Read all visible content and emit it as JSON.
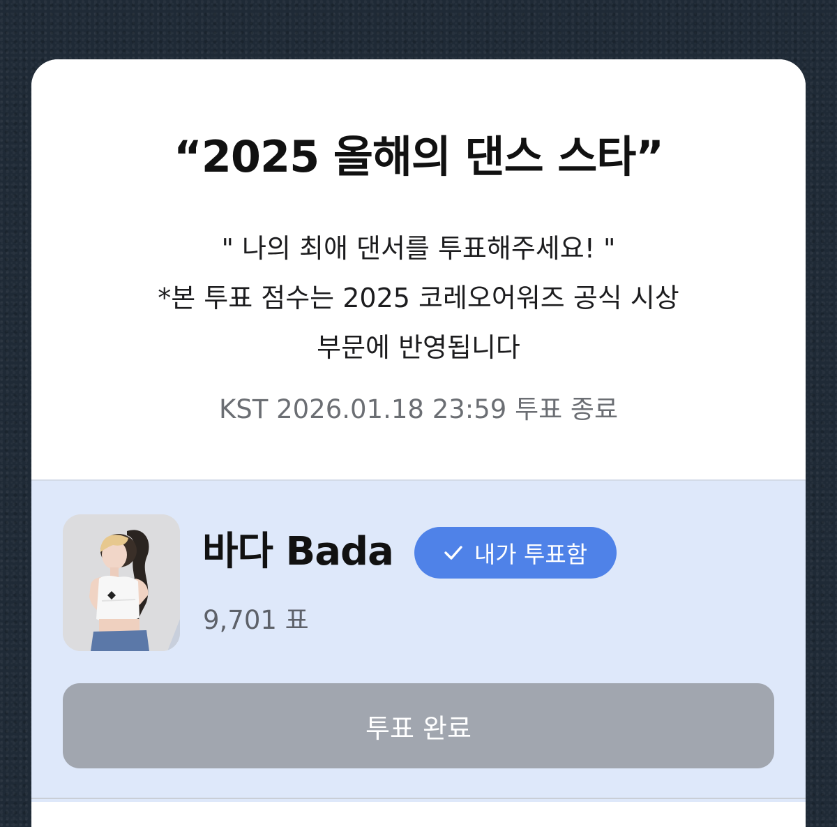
{
  "poll": {
    "title": "“2025 올해의 댄스 스타”",
    "description_lines": [
      "\" 나의 최애 댄서를 투표해주세요! \"",
      "*본 투표 점수는 2025 코레오어워즈 공식 시상",
      "부문에 반영됩니다"
    ],
    "deadline": "KST 2026.01.18 23:59 투표 종료"
  },
  "candidate": {
    "name": "바다 Bada",
    "voted_badge": "내가 투표함",
    "badge_icon": "check-icon",
    "vote_count": "9,701 표",
    "vote_button": "투표 완료"
  },
  "colors": {
    "panel_bg": "#dee8fa",
    "badge_bg": "#4f82e8",
    "button_disabled_bg": "#a1a6af",
    "background": "#1f2a36"
  }
}
